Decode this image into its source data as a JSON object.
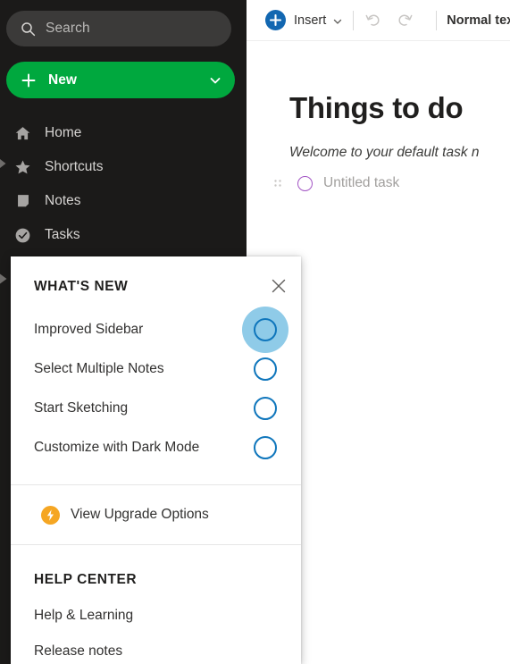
{
  "sidebar": {
    "search": {
      "icon": "search-icon",
      "placeholder": "Search",
      "value": ""
    },
    "new_button": {
      "label": "New",
      "plus_icon": "plus-icon",
      "chevron_icon": "chevron-down-icon",
      "color": "#00a83e"
    },
    "nav_items": [
      {
        "label": "Home",
        "icon": "home-icon"
      },
      {
        "label": "Shortcuts",
        "icon": "star-icon"
      },
      {
        "label": "Notes",
        "icon": "note-icon"
      },
      {
        "label": "Tasks",
        "icon": "check-circle-icon"
      }
    ],
    "background": "#1b1a19"
  },
  "toolbar": {
    "insert_label": "Insert",
    "insert_icon": "plus-circle-icon",
    "insert_chevron": "chevron-down-icon",
    "undo_icon": "undo-icon",
    "redo_icon": "redo-icon",
    "style_label": "Normal text",
    "accent": "#1267b1"
  },
  "document": {
    "title": "Things to do",
    "subtitle": "Welcome to your default task n",
    "task": {
      "handle_icon": "drag-handle-icon",
      "circle_icon": "task-circle-icon",
      "text": "Untitled task",
      "circle_color": "#a254c4"
    }
  },
  "popup": {
    "title": "WHAT'S NEW",
    "close_icon": "close-icon",
    "items": [
      {
        "label": "Improved Sidebar",
        "highlighted": true
      },
      {
        "label": "Select Multiple Notes",
        "highlighted": false
      },
      {
        "label": "Start Sketching",
        "highlighted": false
      },
      {
        "label": "Customize with Dark Mode",
        "highlighted": false
      }
    ],
    "upgrade": {
      "label": "View Upgrade Options",
      "icon": "lightning-bolt-icon",
      "icon_color": "#f5a623"
    },
    "help_center": {
      "heading": "HELP CENTER",
      "links": [
        {
          "label": "Help & Learning"
        },
        {
          "label": "Release notes"
        }
      ]
    },
    "circle_color": "#0f76bc",
    "glow_color": "#8fcbe8"
  }
}
